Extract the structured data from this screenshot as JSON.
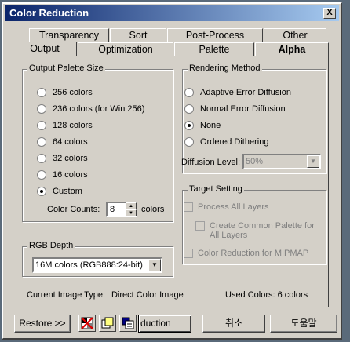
{
  "window": {
    "title": "Color Reduction",
    "close": "X"
  },
  "tabs_back": [
    {
      "label": "Transparency"
    },
    {
      "label": "Sort"
    },
    {
      "label": "Post-Process"
    },
    {
      "label": "Other"
    }
  ],
  "tabs_front": [
    {
      "label": "Output",
      "active": true
    },
    {
      "label": "Optimization"
    },
    {
      "label": "Palette"
    },
    {
      "label": "Alpha"
    }
  ],
  "output_palette": {
    "title": "Output Palette Size",
    "options": [
      {
        "label": "256 colors",
        "selected": false
      },
      {
        "label": "236 colors (for Win 256)",
        "selected": false
      },
      {
        "label": "128 colors",
        "selected": false
      },
      {
        "label": "64 colors",
        "selected": false
      },
      {
        "label": "32 colors",
        "selected": false
      },
      {
        "label": "16 colors",
        "selected": false
      },
      {
        "label": "Custom",
        "selected": true
      }
    ],
    "color_counts_label": "Color Counts:",
    "color_counts_value": "8",
    "colors_suffix": "colors"
  },
  "rgb_depth": {
    "title": "RGB Depth",
    "selected": "16M colors (RGB888:24-bit)"
  },
  "rendering": {
    "title": "Rendering Method",
    "options": [
      {
        "label": "Adaptive Error Diffusion",
        "selected": false
      },
      {
        "label": "Normal Error Diffusion",
        "selected": false
      },
      {
        "label": "None",
        "selected": true
      },
      {
        "label": "Ordered Dithering",
        "selected": false
      }
    ],
    "diffusion_label": "Diffusion Level:",
    "diffusion_value": "50%"
  },
  "target": {
    "title": "Target Setting",
    "process_all": "Process All Layers",
    "common_palette": "Create Common Palette for All Layers",
    "mipmap": "Color Reduction for MIPMAP"
  },
  "status": {
    "image_type_label": "Current Image Type:",
    "image_type_value": "Direct Color Image",
    "used_colors": "Used Colors: 6 colors"
  },
  "buttons": {
    "restore": "Restore >>",
    "reduction": "duction",
    "cancel": "취소",
    "help": "도움말"
  },
  "icons": [
    "no-palette-icon",
    "image-copy-icon",
    "image-layers-icon"
  ]
}
